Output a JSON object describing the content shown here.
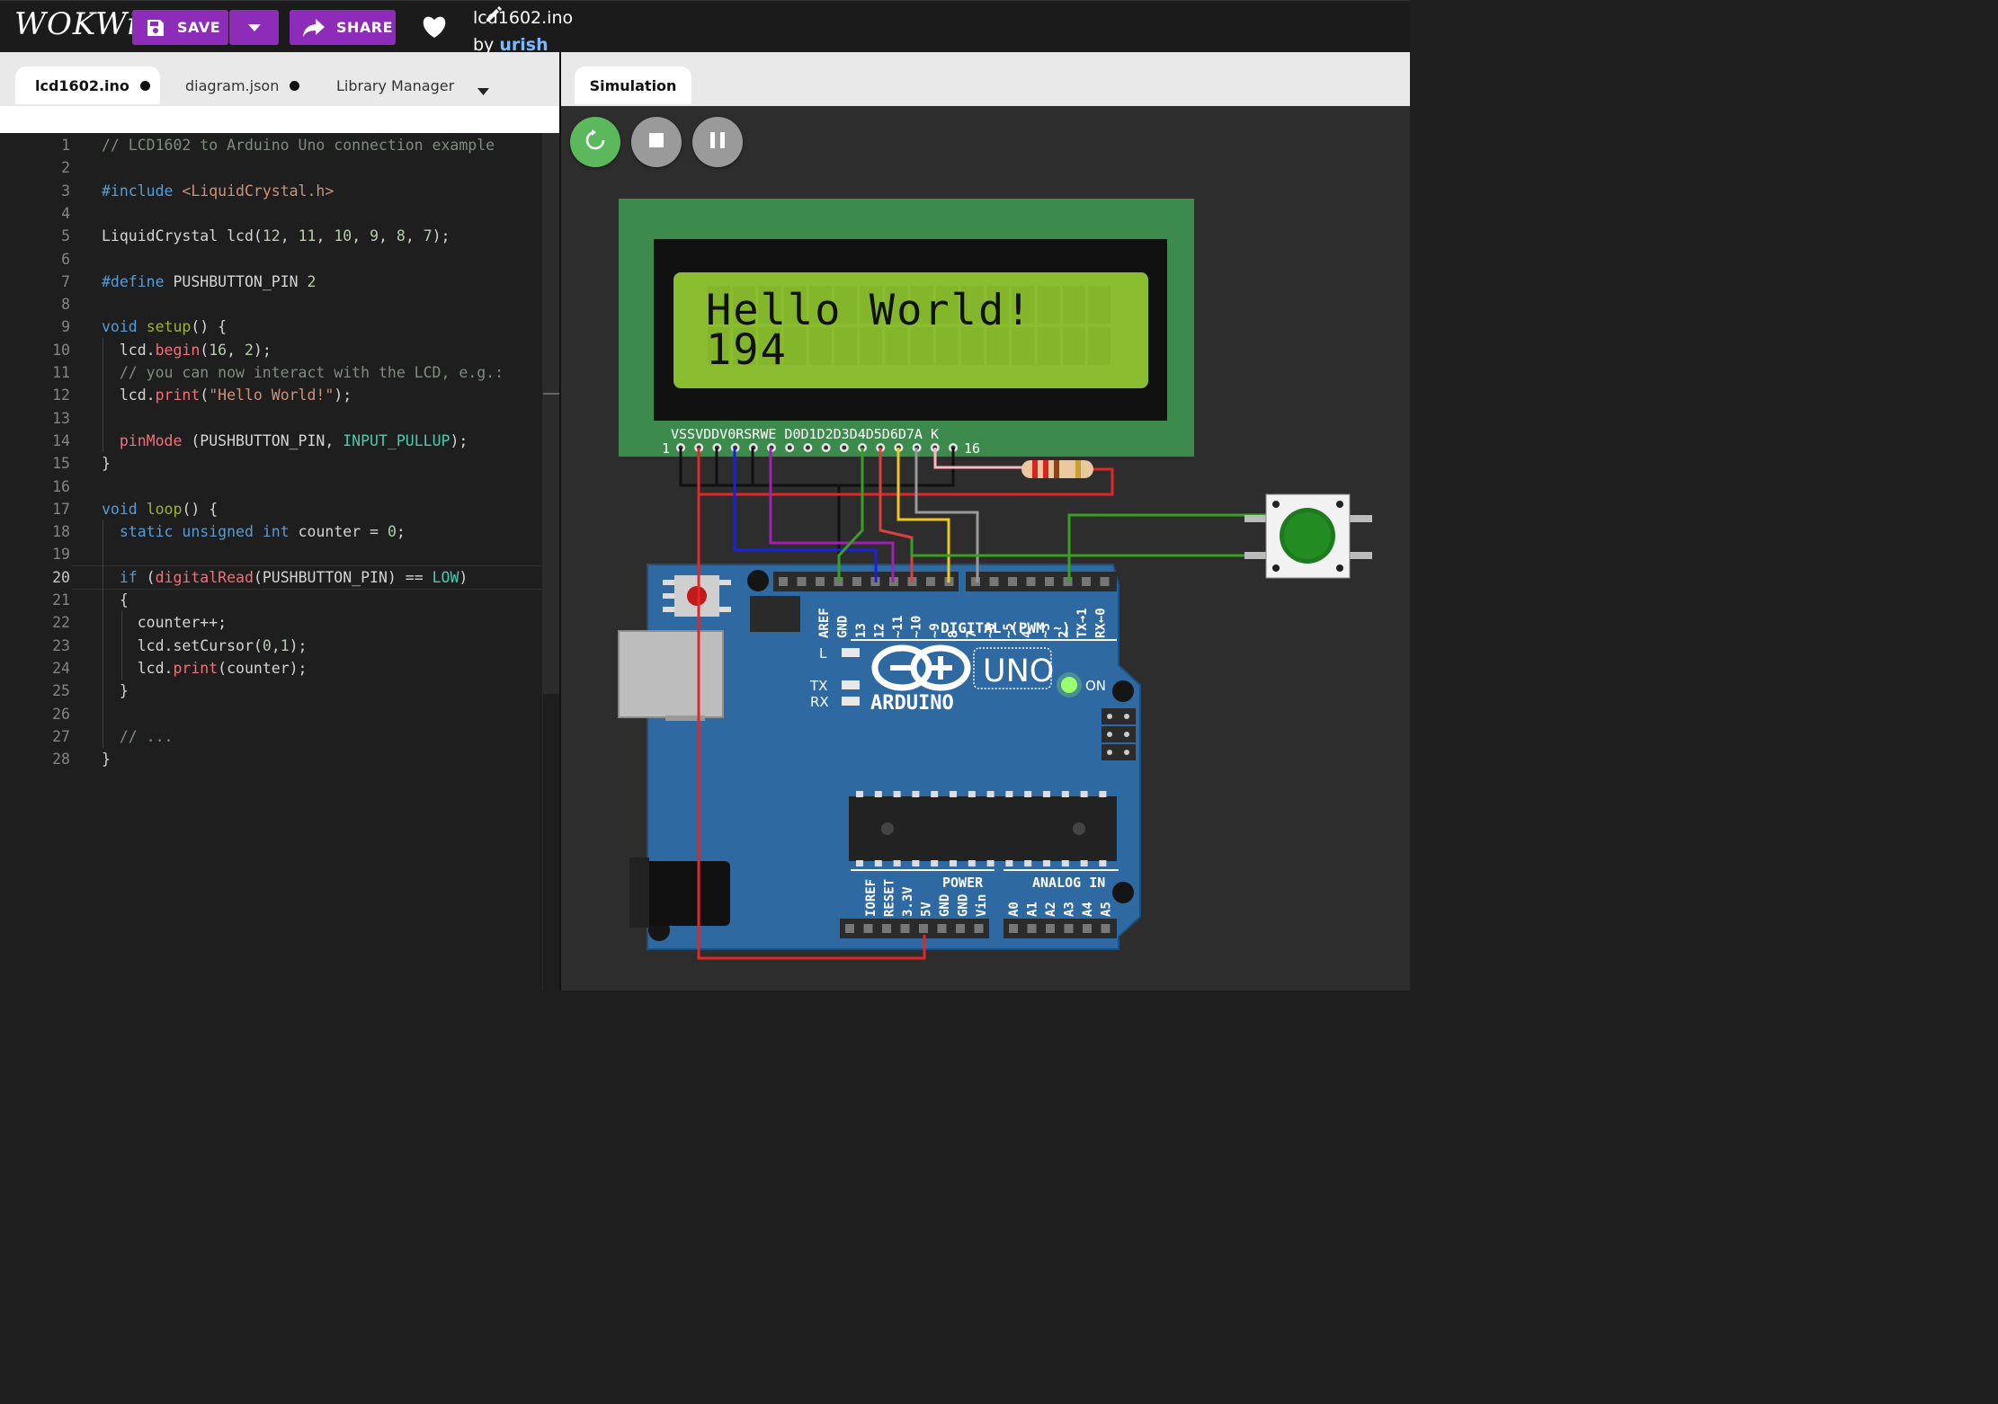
{
  "header": {
    "logo": "WOKWi",
    "save_label": "SAVE",
    "share_label": "SHARE",
    "project_name": "lcd1602.ino",
    "by_label": "by",
    "author": "urish",
    "accent": "#8d2cb8"
  },
  "editor_tabs": [
    {
      "label": "lcd1602.ino",
      "modified": true,
      "active": true
    },
    {
      "label": "diagram.json",
      "modified": true,
      "active": false
    },
    {
      "label": "Library Manager",
      "active": false
    }
  ],
  "sim_tab": {
    "label": "Simulation"
  },
  "code_lines": [
    "// LCD1602 to Arduino Uno connection example",
    "",
    "#include <LiquidCrystal.h>",
    "",
    "LiquidCrystal lcd(12, 11, 10, 9, 8, 7);",
    "",
    "#define PUSHBUTTON_PIN 2",
    "",
    "void setup() {",
    "  lcd.begin(16, 2);",
    "  // you can now interact with the LCD, e.g.:",
    "  lcd.print(\"Hello World!\");",
    "",
    "  pinMode (PUSHBUTTON_PIN, INPUT_PULLUP);",
    "}",
    "",
    "void loop() {",
    "  static unsigned int counter = 0;",
    "",
    "  if (digitalRead(PUSHBUTTON_PIN) == LOW)",
    "  {",
    "    counter++;",
    "    lcd.setCursor(0,1);",
    "    lcd.print(counter);",
    "  }",
    "",
    "  // ...",
    "}"
  ],
  "current_line": 20,
  "lcd": {
    "line1": "Hello World!",
    "line2": "194",
    "pin_labels": "VSSVDDV0RSRWE D0D1D2D3D4D5D6D7A  K",
    "pin_first": "1",
    "pin_last": "16"
  },
  "arduino": {
    "model": "UNO",
    "brand": "ARDUINO",
    "on_label": "ON",
    "tx_label": "TX",
    "rx_label": "RX",
    "l_label": "L",
    "digital_label": "DIGITAL (PWM ~)",
    "power_label": "POWER",
    "analog_label": "ANALOG IN",
    "top_pins": [
      "AREF",
      "GND",
      "13",
      "12",
      "~11",
      "~10",
      "~9",
      "8",
      "7",
      "~6",
      "~5",
      "4",
      "~3",
      "2",
      "TX→1",
      "RX←0"
    ],
    "power_pins": [
      "IOREF",
      "RESET",
      "3.3V",
      "5V",
      "GND",
      "GND",
      "Vin"
    ],
    "analog_pins": [
      "A0",
      "A1",
      "A2",
      "A3",
      "A4",
      "A5"
    ]
  }
}
